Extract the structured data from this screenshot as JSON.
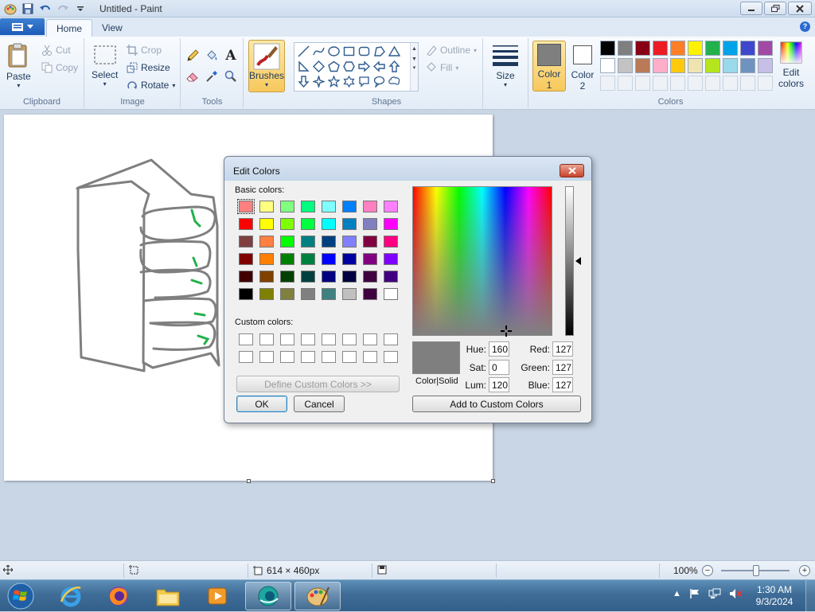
{
  "window": {
    "title": "Untitled - Paint"
  },
  "tabs": [
    {
      "label": "Home"
    },
    {
      "label": "View"
    }
  ],
  "ribbon": {
    "clipboard": {
      "label": "Clipboard",
      "paste": "Paste",
      "cut": "Cut",
      "copy": "Copy"
    },
    "image": {
      "label": "Image",
      "select": "Select",
      "crop": "Crop",
      "resize": "Resize",
      "rotate": "Rotate"
    },
    "tools": {
      "label": "Tools"
    },
    "brushes": {
      "label": "Brushes"
    },
    "shapes": {
      "label": "Shapes",
      "outline": "Outline",
      "fill": "Fill"
    },
    "size": {
      "label": "Size"
    },
    "colors": {
      "label": "Colors",
      "color1_line1": "Color",
      "color1_line2": "1",
      "color2_line1": "Color",
      "color2_line2": "2",
      "edit_line1": "Edit",
      "edit_line2": "colors",
      "color1_value": "#7f7f7f",
      "color2_value": "#ffffff",
      "palette_row1": [
        "#000000",
        "#7f7f7f",
        "#880015",
        "#ed1c24",
        "#ff7f27",
        "#fff200",
        "#22b14c",
        "#00a2e8",
        "#3f48cc",
        "#a349a4"
      ],
      "palette_row2": [
        "#ffffff",
        "#c3c3c3",
        "#b97a57",
        "#ffaec9",
        "#ffc90e",
        "#efe4b0",
        "#b5e61d",
        "#99d9ea",
        "#7092be",
        "#c8bfe7"
      ]
    }
  },
  "dialog": {
    "title": "Edit Colors",
    "basic_colors_label": "Basic colors:",
    "custom_colors_label": "Custom colors:",
    "define_custom": "Define Custom Colors >>",
    "ok": "OK",
    "cancel": "Cancel",
    "add_custom": "Add to Custom Colors",
    "color_solid": "Color|Solid",
    "hue_label": "Hue:",
    "hue": "160",
    "sat_label": "Sat:",
    "sat": "0",
    "lum_label": "Lum:",
    "lum": "120",
    "red_label": "Red:",
    "red": "127",
    "green_label": "Green:",
    "green": "127",
    "blue_label": "Blue:",
    "blue": "127",
    "basic_colors": [
      [
        "#ff8080",
        "#ffff80",
        "#80ff80",
        "#00ff80",
        "#80ffff",
        "#0080ff",
        "#ff80c0",
        "#ff80ff"
      ],
      [
        "#ff0000",
        "#ffff00",
        "#80ff00",
        "#00ff40",
        "#00ffff",
        "#0080c0",
        "#8080c0",
        "#ff00ff"
      ],
      [
        "#804040",
        "#ff8040",
        "#00ff00",
        "#008080",
        "#004080",
        "#8080ff",
        "#800040",
        "#ff0080"
      ],
      [
        "#800000",
        "#ff8000",
        "#008000",
        "#008040",
        "#0000ff",
        "#0000a0",
        "#800080",
        "#8000ff"
      ],
      [
        "#400000",
        "#804000",
        "#004000",
        "#004040",
        "#000080",
        "#000040",
        "#400040",
        "#400080"
      ],
      [
        "#000000",
        "#808000",
        "#808040",
        "#808080",
        "#408080",
        "#c0c0c0",
        "#400040",
        "#ffffff"
      ]
    ]
  },
  "status": {
    "size": "614 × 460px",
    "zoom": "100%"
  },
  "clock": {
    "time": "1:30 AM",
    "date": "9/3/2024"
  }
}
